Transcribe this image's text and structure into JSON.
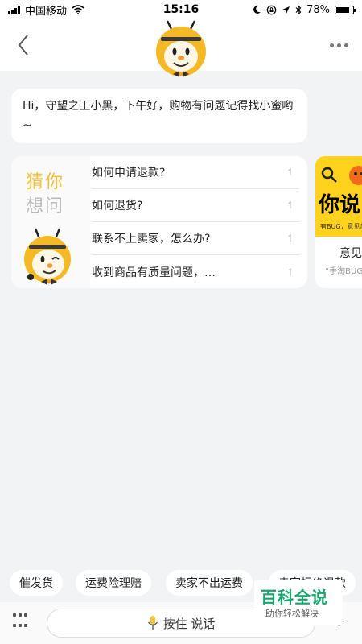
{
  "status_bar": {
    "carrier": "中国移动",
    "time": "15:16",
    "battery_percent": "78%",
    "battery_level": 0.78,
    "icons": [
      "signal-icon",
      "wifi-icon",
      "moon-icon",
      "lock-rotation-icon",
      "location-icon",
      "bluetooth-icon",
      "battery-icon"
    ]
  },
  "nav": {
    "back_icon": "chevron-left-icon",
    "more_icon": "more-dots-icon",
    "avatar_icon": "bee-mascot-icon"
  },
  "greeting": {
    "text": "Hi，守望之王小黑，下午好，购物有问题记得找小蜜哟~"
  },
  "faq": {
    "title_line1": "猜你",
    "title_line2": "想问",
    "items": [
      {
        "label": "如何申请退款?"
      },
      {
        "label": "如何退货?"
      },
      {
        "label": "联系不上卖家，怎么办?"
      },
      {
        "label": "收到商品有质量问题，…"
      }
    ],
    "item_arrow": "↿"
  },
  "promo": {
    "image_text": "你说",
    "image_sub": "有BUG，意见反",
    "title": "意见",
    "subtitle": "“手淘BUG"
  },
  "quick_replies": [
    {
      "label": "催发货"
    },
    {
      "label": "运费险理赔"
    },
    {
      "label": "卖家不出运费"
    },
    {
      "label": "卖家拒绝退款"
    }
  ],
  "input_bar": {
    "voice_label": "按住 说话",
    "plus_label": "+"
  },
  "watermark": {
    "main": "百科全说",
    "sub": "助你轻松解决"
  },
  "colors": {
    "accent": "#f4c23a",
    "background": "#f2f3f5",
    "watermark": "#1aa36b"
  }
}
